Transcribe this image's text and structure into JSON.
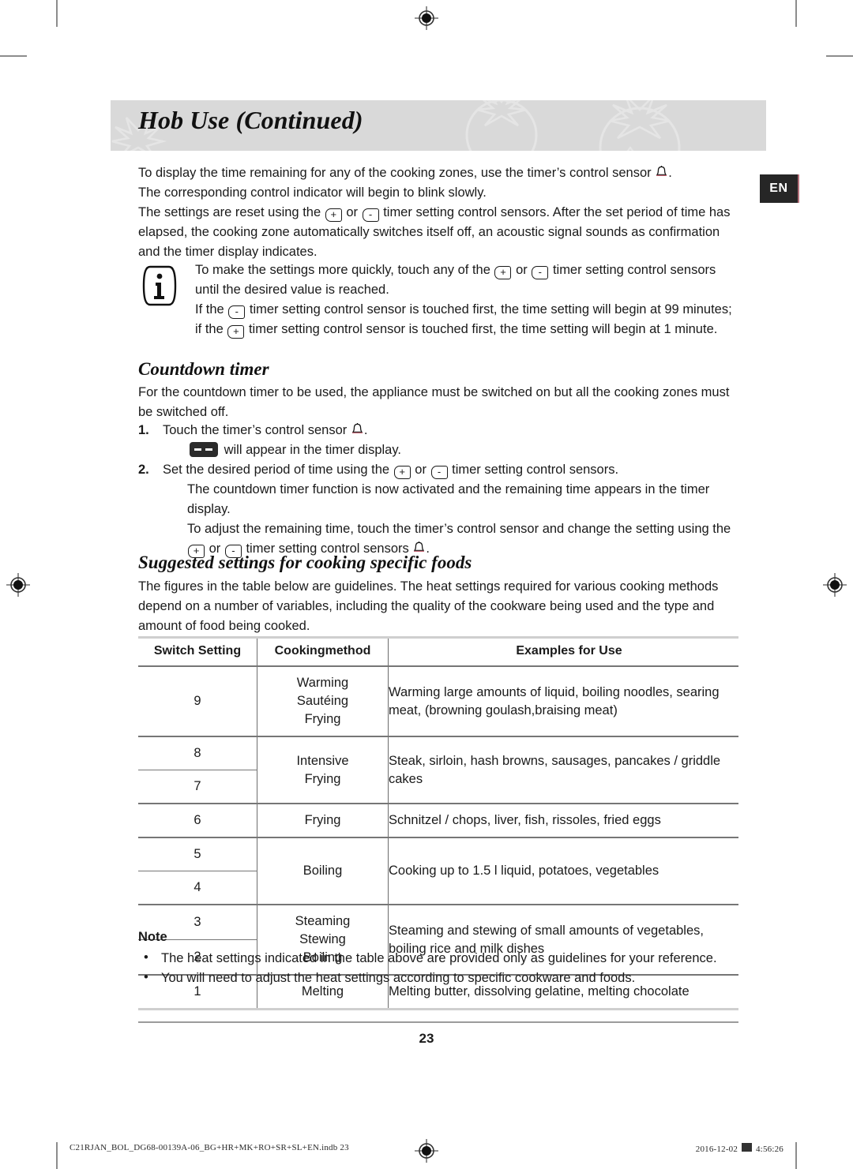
{
  "header": {
    "chapter_title": "Hob Use (Continued)",
    "language_tab": "EN"
  },
  "intro": {
    "p1_a": "To display the time remaining for any of the cooking zones, use the timer’s control sensor",
    "p1_b": ".",
    "p2": "The corresponding control indicator will begin to blink slowly.",
    "p3_a": "The settings are reset using the",
    "p3_or": "or",
    "p3_b": "timer setting control sensors. After the set period of time has elapsed, the cooking zone automatically switches itself off, an acoustic signal sounds as confirmation and the timer display indicates."
  },
  "info_note": {
    "icon": "information-icon",
    "line1_a": "To make the settings more quickly, touch any of the",
    "line1_or": "or",
    "line1_b": "timer setting control sensors until the desired value is reached.",
    "line2_a": "If the",
    "line2_b": "timer setting control sensor is touched first, the time setting will begin at 99 minutes; if the",
    "line2_c": "timer setting control sensor is touched first, the time setting will begin at 1 minute."
  },
  "countdown": {
    "heading": "Countdown timer",
    "intro": "For the countdown timer to be used, the appliance must be switched on but all the cooking zones must be switched off.",
    "step1_num": "1.",
    "step1_a": "Touch the timer’s control sensor",
    "step1_b": ".",
    "step1_sub": "will appear in the timer display.",
    "step2_num": "2.",
    "step2_a": "Set the desired period of time using the",
    "step2_or": "or",
    "step2_b": "timer setting control sensors.",
    "step2_sub1": "The countdown timer function is now activated and the remaining time appears in the timer display.",
    "step2_sub2_a": "To adjust the remaining time, touch the timer’s control sensor and change the setting using the",
    "step2_sub2_or": "or",
    "step2_sub2_b": "timer setting control sensors",
    "step2_sub2_c": "."
  },
  "suggested": {
    "heading": "Suggested settings for cooking specific foods",
    "intro": "The figures in the table below are guidelines. The heat settings required for various cooking methods depend on a number of variables, including the quality of the cookware being used and the type and amount of food being cooked."
  },
  "table": {
    "columns": [
      "Switch Setting",
      "Cookingmethod",
      "Examples for Use"
    ],
    "groups": [
      {
        "settings": [
          "9"
        ],
        "method": [
          "Warming",
          "Sautéing",
          "Frying"
        ],
        "example": "Warming large amounts of liquid, boiling noodles, searing meat, (browning goulash,braising meat)"
      },
      {
        "settings": [
          "8",
          "7"
        ],
        "method": [
          "Intensive",
          "Frying"
        ],
        "example": "Steak, sirloin, hash browns, sausages, pancakes / griddle cakes"
      },
      {
        "settings": [
          "6"
        ],
        "method": [
          "Frying"
        ],
        "example": "Schnitzel / chops, liver, fish, rissoles, fried eggs"
      },
      {
        "settings": [
          "5",
          "4"
        ],
        "method": [
          "Boiling"
        ],
        "example": "Cooking up to 1.5 l liquid, potatoes, vegetables"
      },
      {
        "settings": [
          "3",
          "2"
        ],
        "method": [
          "Steaming",
          "Stewing",
          "Boiling"
        ],
        "example": "Steaming and stewing of small amounts of vegetables, boiling rice and milk dishes"
      },
      {
        "settings": [
          "1"
        ],
        "method": [
          "Melting"
        ],
        "example": "Melting butter, dissolving gelatine, melting chocolate"
      }
    ]
  },
  "note": {
    "title": "Note",
    "bullet_char": "•",
    "items": [
      "The heat settings indicated in the table above are provided only as guidelines for your reference.",
      "You will need to adjust the heat settings according to specific cookware and foods."
    ]
  },
  "footer": {
    "page_number": "23",
    "slug_left": "C21RJAN_BOL_DG68-00139A-06_BG+HR+MK+RO+SR+SL+EN.indb   23",
    "slug_date": "2016-12-02",
    "slug_time": "4:56:26"
  },
  "icons": {
    "timer_bell": "bell-icon",
    "plus_sensor": "+",
    "minus_sensor": "-",
    "registration": "registration-target-icon"
  },
  "colors": {
    "band": "#d9d9d9",
    "tab_bg": "#262626",
    "rule": "#767676",
    "soft_rule": "#cfcfcf"
  }
}
